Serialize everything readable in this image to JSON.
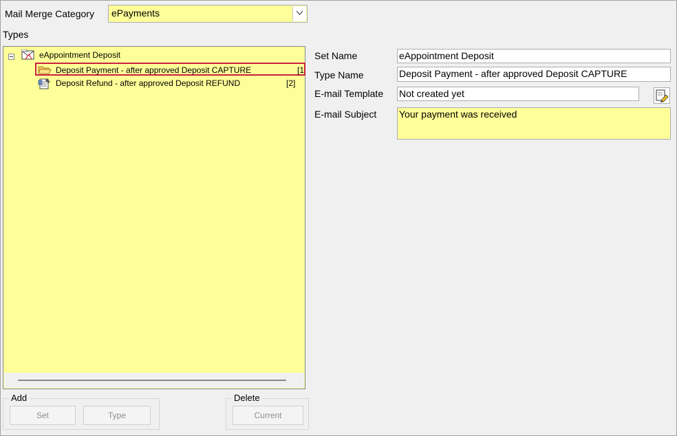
{
  "category": {
    "label": "Mail Merge Category",
    "value": "ePayments"
  },
  "types_label": "Types",
  "tree": {
    "root": {
      "label": "eAppointment Deposit"
    },
    "children": [
      {
        "label": "Deposit Payment - after approved Deposit CAPTURE",
        "count": "[1"
      },
      {
        "label": "Deposit Refund - after approved Deposit REFUND",
        "count": "[2]"
      }
    ]
  },
  "form": {
    "set_name_label": "Set Name",
    "set_name_value": "eAppointment Deposit",
    "type_name_label": "Type Name",
    "type_name_value": "Deposit Payment - after approved Deposit CAPTURE",
    "email_template_label": "E-mail Template",
    "email_template_value": "Not created yet",
    "email_subject_label": "E-mail Subject",
    "email_subject_value": "Your payment was received"
  },
  "add_group": {
    "title": "Add",
    "set_button": "Set",
    "type_button": "Type"
  },
  "delete_group": {
    "title": "Delete",
    "current_button": "Current"
  },
  "colors": {
    "field_yellow": "#ffff99",
    "selection_border": "#c8213d",
    "background": "#f0f0f0"
  },
  "icons": {
    "combo_arrow": "chevron-down-icon",
    "root_node": "envelope-set-icon",
    "child_selected": "open-folder-icon",
    "child_other": "document-edit-icon",
    "template_edit": "edit-template-icon",
    "expander": "collapse-icon"
  }
}
